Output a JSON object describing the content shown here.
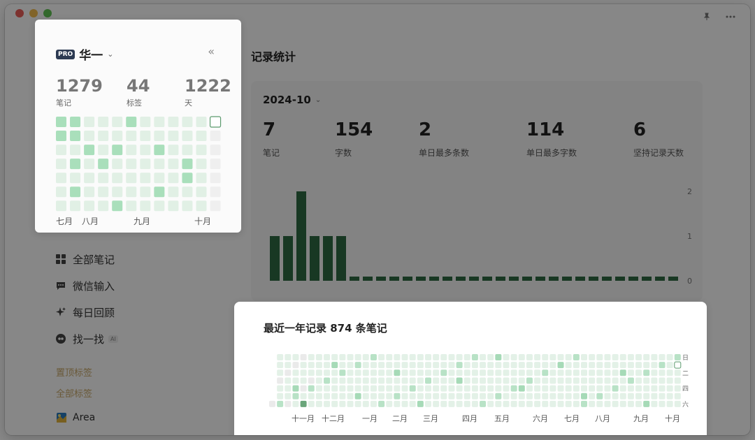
{
  "window": {
    "traffic_lights": [
      "#ec5f5a",
      "#f4be4f",
      "#61c554"
    ],
    "top_icons": [
      "pin-icon",
      "more-icon"
    ]
  },
  "popover": {
    "pro_label": "PRO",
    "user_name": "华一",
    "stats": [
      {
        "value": "1279",
        "label": "笔记"
      },
      {
        "value": "44",
        "label": "标签"
      },
      {
        "value": "1222",
        "label": "天"
      }
    ],
    "months": [
      "七月",
      "八月",
      "九月",
      "十月"
    ]
  },
  "sidebar": {
    "nav": [
      {
        "label": "全部笔记",
        "icon": "grid-icon"
      },
      {
        "label": "微信输入",
        "icon": "chat-icon"
      },
      {
        "label": "每日回顾",
        "icon": "sparkle-icon"
      },
      {
        "label": "找一找",
        "icon": "search-icon",
        "badge": "AI"
      }
    ],
    "pinned_tags": "置顶标签",
    "all_tags": "全部标签",
    "area": "Area"
  },
  "main": {
    "title": "记录统计",
    "month": "2024-10",
    "stats": [
      {
        "value": "7",
        "label": "笔记"
      },
      {
        "value": "154",
        "label": "字数"
      },
      {
        "value": "2",
        "label": "单日最多条数"
      },
      {
        "value": "114",
        "label": "单日最多字数"
      },
      {
        "value": "6",
        "label": "坚持记录天数"
      }
    ]
  },
  "heatmap": {
    "title": "最近一年记录 874 条笔记",
    "weekday_labels": [
      "日",
      "二",
      "四",
      "六"
    ],
    "months": [
      "十一月",
      "十二月",
      "一月",
      "二月",
      "三月",
      "四月",
      "五月",
      "六月",
      "七月",
      "八月",
      "九月",
      "十月"
    ]
  },
  "chart_data": {
    "type": "bar",
    "title": "",
    "xlabel": "",
    "ylabel": "",
    "ylim": [
      0,
      2
    ],
    "yticks": [
      "0",
      "1",
      "2"
    ],
    "values": [
      1,
      1,
      2,
      1,
      1,
      1,
      0,
      0,
      0,
      0,
      0,
      0,
      0,
      0,
      0,
      0,
      0,
      0,
      0,
      0,
      0,
      0,
      0,
      0,
      0,
      0,
      0,
      0,
      0,
      0,
      0
    ],
    "color": "#2f6b43"
  }
}
